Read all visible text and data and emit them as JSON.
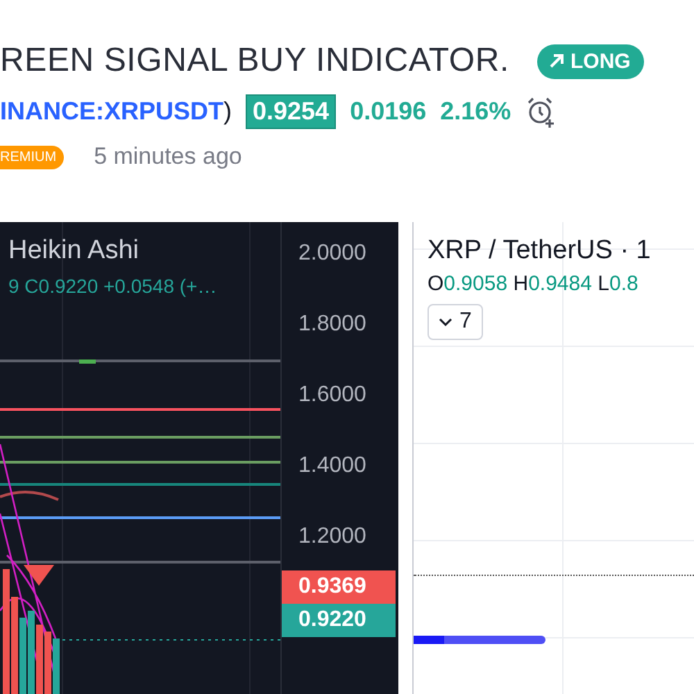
{
  "idea": {
    "title": "REEN SIGNAL BUY INDICATOR.",
    "direction_badge": "LONG",
    "symbol": "INANCE:XRPUSDT",
    "symbol_close": ")",
    "price": "0.9254",
    "change": "0.0196",
    "change_percent": "2.16%",
    "tier_badge": "REMIUM",
    "published": "5 minutes ago"
  },
  "dark_chart": {
    "style": "Heikin Ashi",
    "legend": "9 C0.9220 +0.0548 (+…",
    "axis_ticks": [
      "2.0000",
      "1.8000",
      "1.6000",
      "1.4000",
      "1.2000"
    ],
    "price_labels": [
      {
        "label": "0.9369",
        "color": "#f05350"
      },
      {
        "label": "0.9220",
        "color": "#26a69a"
      }
    ]
  },
  "light_chart": {
    "title": "XRP / TetherUS · 1",
    "ohlc": [
      {
        "key": "O",
        "value": "0.9058"
      },
      {
        "key": "H",
        "value": "0.9484"
      },
      {
        "key": "L",
        "value": "0.8"
      }
    ],
    "indicators_button": "7"
  }
}
